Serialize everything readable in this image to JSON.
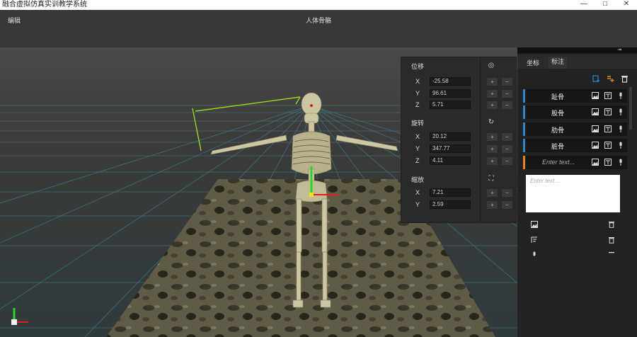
{
  "window": {
    "title": "融合虚拟仿真实训教学系统",
    "controls": [
      "—",
      "□",
      "✕"
    ]
  },
  "header": {
    "edit_label": "编辑",
    "center_title": "人体骨骼"
  },
  "transform": {
    "position": {
      "title": "位移",
      "x": "-25.58",
      "y": "96.61",
      "z": "5.71"
    },
    "rotation": {
      "title": "旋转",
      "x": "20.12",
      "y": "347.77",
      "z": "4.11"
    },
    "scale": {
      "title": "缩放",
      "x": "7.21",
      "y": "2.59"
    },
    "axis_labels": {
      "x": "X",
      "y": "Y",
      "z": "Z"
    },
    "plus": "+",
    "minus": "−"
  },
  "panel": {
    "collapse_glyph": "⇥",
    "tabs": [
      {
        "label": "坐标"
      },
      {
        "label": "标注"
      }
    ],
    "parts": [
      {
        "label": "趾骨",
        "color": "#2d86c9"
      },
      {
        "label": "股骨",
        "color": "#2d86c9"
      },
      {
        "label": "肋骨",
        "color": "#2d86c9"
      },
      {
        "label": "脏骨",
        "color": "#2d86c9"
      },
      {
        "placeholder": "Enter text...",
        "color": "#e6861a"
      }
    ],
    "notes_placeholder": "Enter text..."
  },
  "colors": {
    "accent": "#2d86c9",
    "warn": "#e6861a",
    "grid": "#3c9aa3"
  }
}
